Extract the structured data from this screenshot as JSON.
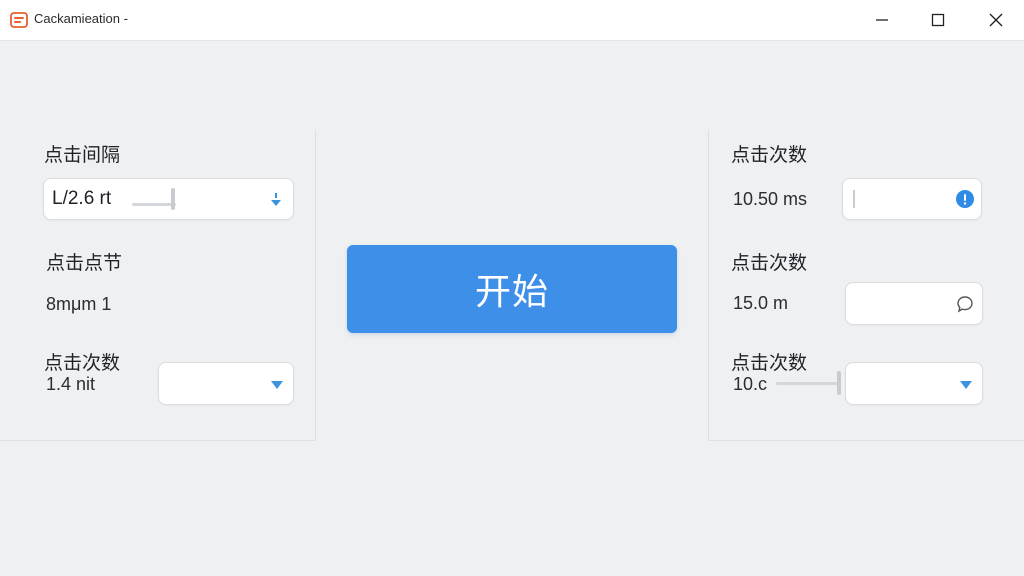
{
  "window": {
    "title": "Cackamieation -",
    "controls": {
      "minimize": "minimize-icon",
      "maximize": "maximize-icon",
      "close": "close-icon"
    }
  },
  "left_panel": {
    "interval": {
      "label": "点击间隔",
      "value": "L/2.6 rt"
    },
    "section2": {
      "label": "点击点节",
      "value": "8mμm 1"
    },
    "count": {
      "label": "点击次数",
      "value": "1.4 nit"
    }
  },
  "start_button": {
    "label": "开始"
  },
  "right_panel": {
    "row1": {
      "label": "点击次数",
      "value": "10.50 ms",
      "icon": "info-icon"
    },
    "row2": {
      "label": "点击次数",
      "value": "15.0 m",
      "icon": "chat-bubble-icon"
    },
    "row3": {
      "label": "点击次数",
      "value": "10.c"
    }
  },
  "colors": {
    "accent": "#3d8fe8",
    "app_icon": "#e8602c",
    "info_blue": "#2f8be6",
    "dropdown_caret": "#3a93dd"
  }
}
